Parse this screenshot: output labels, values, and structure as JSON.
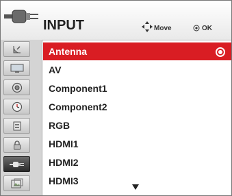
{
  "header": {
    "title": "INPUT",
    "move_label": "Move",
    "ok_label": "OK"
  },
  "sidebar": {
    "items": [
      {
        "icon": "satellite-dish-icon"
      },
      {
        "icon": "monitor-icon"
      },
      {
        "icon": "speaker-icon"
      },
      {
        "icon": "clock-icon"
      },
      {
        "icon": "option-icon"
      },
      {
        "icon": "lock-icon"
      },
      {
        "icon": "input-plug-icon",
        "active": true
      },
      {
        "icon": "photo-icon"
      }
    ]
  },
  "inputs": {
    "items": [
      {
        "label": "Antenna",
        "selected": true
      },
      {
        "label": "AV"
      },
      {
        "label": "Component1"
      },
      {
        "label": "Component2"
      },
      {
        "label": "RGB"
      },
      {
        "label": "HDMI1"
      },
      {
        "label": "HDMI2"
      },
      {
        "label": "HDMI3"
      }
    ]
  },
  "colors": {
    "highlight": "#d91d23",
    "sidebar_bg": "#d4d4d4"
  }
}
